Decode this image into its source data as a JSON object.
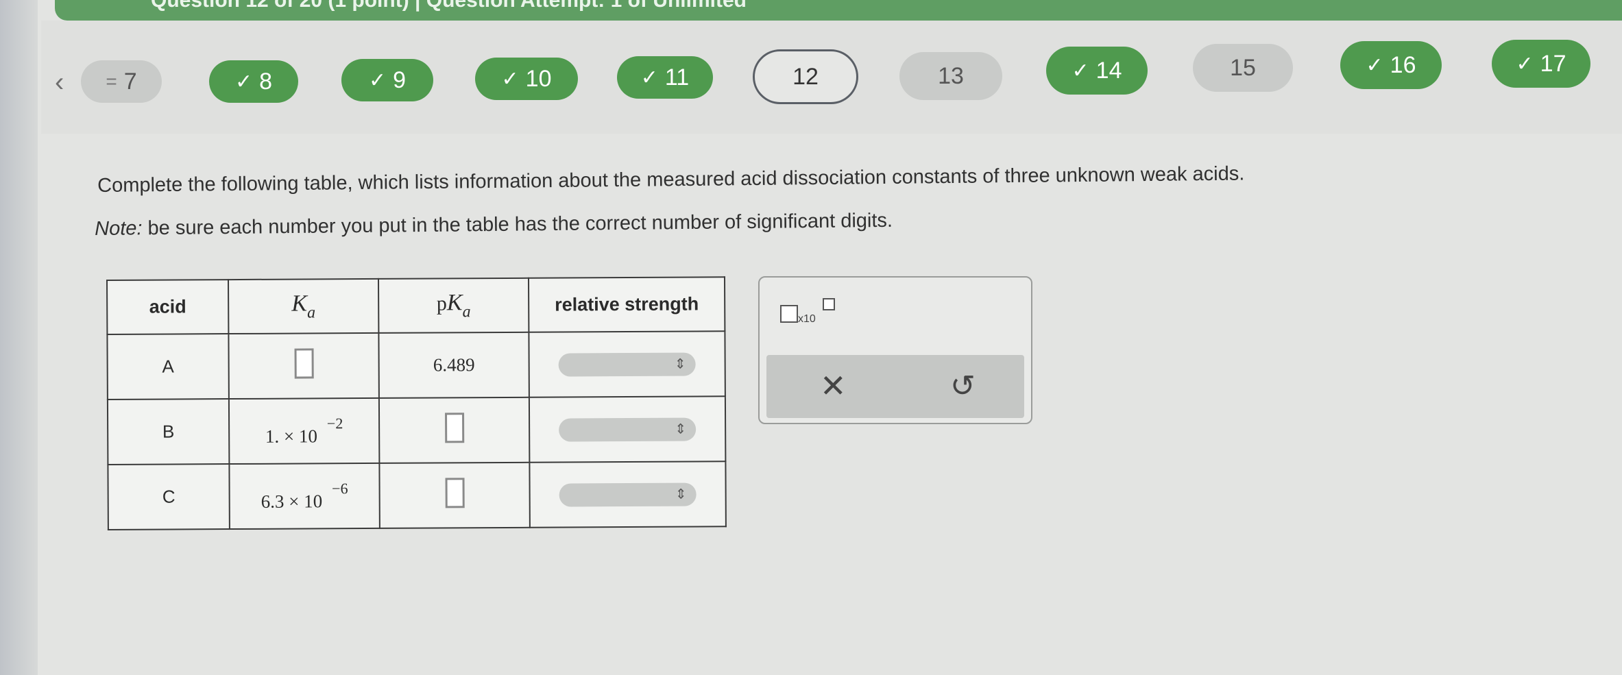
{
  "header": {
    "title": "Question 12 of 20 (1 point) | Question Attempt: 1 of Unlimited"
  },
  "nav": {
    "prev_icon": "chevron-left-icon",
    "questions": [
      {
        "label": "7",
        "prefix": "=",
        "status": "partial"
      },
      {
        "label": "8",
        "status": "done"
      },
      {
        "label": "9",
        "status": "done"
      },
      {
        "label": "10",
        "status": "done"
      },
      {
        "label": "11",
        "status": "done"
      },
      {
        "label": "12",
        "status": "current"
      },
      {
        "label": "13",
        "status": "unanswered"
      },
      {
        "label": "14",
        "status": "done"
      },
      {
        "label": "15",
        "status": "unanswered"
      },
      {
        "label": "16",
        "status": "done"
      },
      {
        "label": "17",
        "status": "done"
      }
    ]
  },
  "question": {
    "prompt": "Complete the following table, which lists information about the measured acid dissociation constants of three unknown weak acids.",
    "note_label": "Note:",
    "note_text": " be sure each number you put in the table has the correct number of significant digits."
  },
  "table": {
    "headers": {
      "acid": "acid",
      "ka_symbol": "K",
      "ka_sub": "a",
      "pka_prefix": "p",
      "pka_symbol": "K",
      "pka_sub": "a",
      "strength": "relative strength"
    },
    "rows": [
      {
        "acid": "A",
        "ka": "",
        "pka": "6.489",
        "strength": ""
      },
      {
        "acid": "B",
        "ka_mantissa": "1. × 10",
        "ka_exp": "−2",
        "pka": "",
        "strength": ""
      },
      {
        "acid": "C",
        "ka_mantissa": "6.3 × 10",
        "ka_exp": "−6",
        "pka": "",
        "strength": ""
      }
    ]
  },
  "panel": {
    "sci_label": "x10",
    "clear_symbol": "✕",
    "undo_symbol": "↺"
  },
  "colors": {
    "done": "#4f9a4e",
    "topbar": "#5f9e63",
    "current_border": "#5a5f66"
  }
}
